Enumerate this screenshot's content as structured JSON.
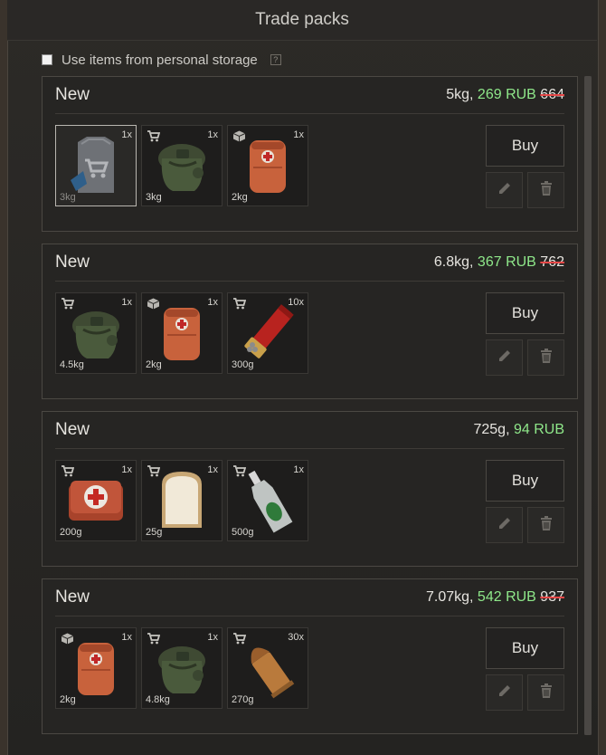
{
  "window": {
    "title": "Trade packs"
  },
  "storage_option": {
    "label": "Use items from personal storage",
    "checked": false,
    "help": "?"
  },
  "buttons": {
    "buy_label": "Buy"
  },
  "colors": {
    "price": "#8fe88a",
    "strike": "#e64848",
    "accent_border": "#b9b6b0"
  },
  "packs": [
    {
      "name": "New",
      "weight": "5kg,",
      "price": "269 RUB",
      "old_price": "664",
      "items": [
        {
          "icon": "armor-plate",
          "type": "cart",
          "qty": "1x",
          "weight": "3kg",
          "selected": true
        },
        {
          "icon": "backpack",
          "type": "cart",
          "qty": "1x",
          "weight": "3kg",
          "selected": false
        },
        {
          "icon": "medkit",
          "type": "box",
          "qty": "1x",
          "weight": "2kg",
          "selected": false
        }
      ]
    },
    {
      "name": "New",
      "weight": "6.8kg,",
      "price": "367 RUB",
      "old_price": "762",
      "items": [
        {
          "icon": "backpack",
          "type": "cart",
          "qty": "1x",
          "weight": "4.5kg",
          "selected": false
        },
        {
          "icon": "medkit",
          "type": "box",
          "qty": "1x",
          "weight": "2kg",
          "selected": false
        },
        {
          "icon": "shotgun-shell",
          "type": "cart",
          "qty": "10x",
          "weight": "300g",
          "selected": false
        }
      ]
    },
    {
      "name": "New",
      "weight": "725g,",
      "price": "94 RUB",
      "old_price": "",
      "items": [
        {
          "icon": "first-aid-tin",
          "type": "cart",
          "qty": "1x",
          "weight": "200g",
          "selected": false
        },
        {
          "icon": "bread-slice",
          "type": "cart",
          "qty": "1x",
          "weight": "25g",
          "selected": false
        },
        {
          "icon": "bottle",
          "type": "cart",
          "qty": "1x",
          "weight": "500g",
          "selected": false
        }
      ]
    },
    {
      "name": "New",
      "weight": "7.07kg,",
      "price": "542 RUB",
      "old_price": "937",
      "items": [
        {
          "icon": "medkit",
          "type": "box",
          "qty": "1x",
          "weight": "2kg",
          "selected": false
        },
        {
          "icon": "backpack",
          "type": "cart",
          "qty": "1x",
          "weight": "4.8kg",
          "selected": false
        },
        {
          "icon": "bullet",
          "type": "cart",
          "qty": "30x",
          "weight": "270g",
          "selected": false
        }
      ]
    }
  ]
}
